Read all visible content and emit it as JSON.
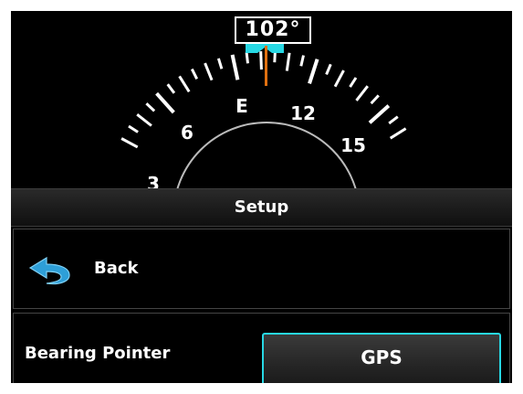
{
  "compass": {
    "heading_readout": "102°",
    "heading_value": 102,
    "bug_color": "#27d8e4",
    "pointer_color": "#e07010",
    "cardinal_labels": [
      "3",
      "6",
      "E",
      "12",
      "15"
    ]
  },
  "title_bar": {
    "title": "Setup"
  },
  "back_row": {
    "label": "Back",
    "icon": "back-arrow-icon",
    "icon_color": "#2e9fd8"
  },
  "bearing_row": {
    "label": "Bearing Pointer",
    "value": "GPS",
    "accent_color": "#27d8e4"
  }
}
